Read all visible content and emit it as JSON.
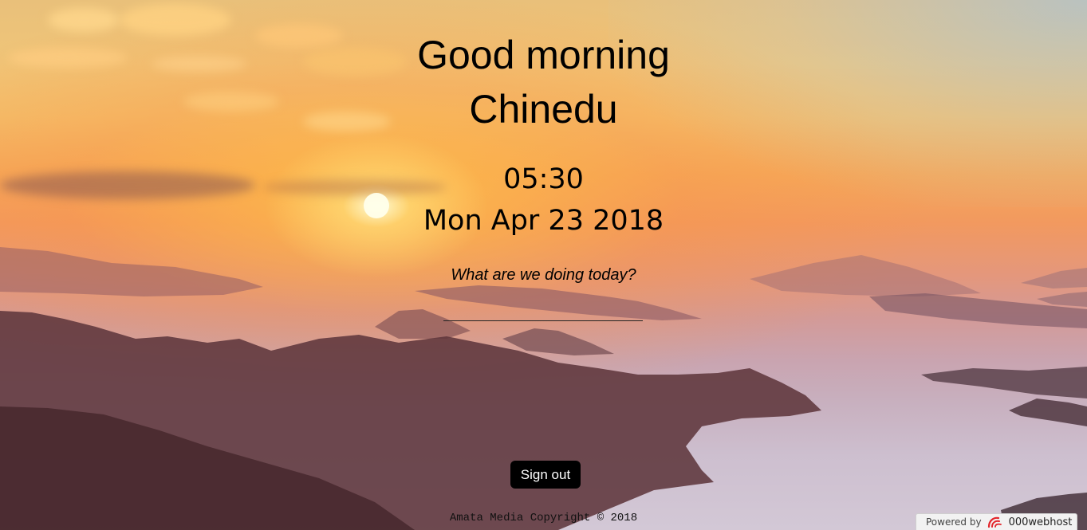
{
  "greeting": {
    "salutation": "Good morning",
    "name": "Chinedu"
  },
  "clock": {
    "time": "05:30",
    "date": "Mon Apr 23 2018"
  },
  "focus": {
    "prompt": "What are we doing today?",
    "value": ""
  },
  "actions": {
    "sign_out_label": "Sign out"
  },
  "footer": {
    "copyright": "Amata Media Copyright © 2018"
  },
  "host_badge": {
    "prefix": "Powered by",
    "brand": "000webhost",
    "icon": "000webhost-logo-icon",
    "brand_color": "#e3262c"
  },
  "background": {
    "icon": "sunrise-mountain-landscape"
  }
}
